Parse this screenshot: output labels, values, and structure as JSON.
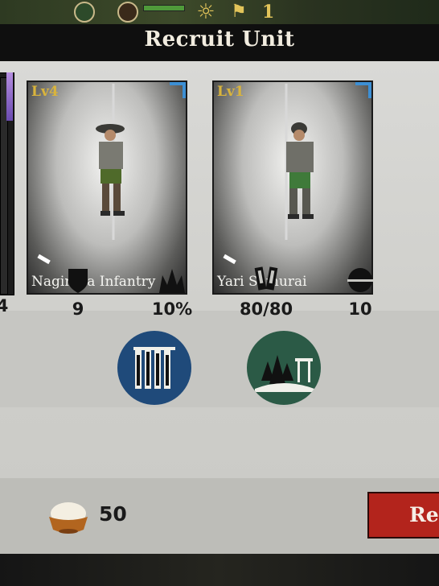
{
  "header": {
    "title": "Recruit Unit",
    "top_counter": "1"
  },
  "cards": [
    {
      "level": "Lv4",
      "name": "Naginata Infantry",
      "accent": "#3d8fd4"
    },
    {
      "level": "Lv1",
      "name": "Yari Samurai",
      "accent": "#3d8fd4"
    }
  ],
  "stats": [
    {
      "icon": "attack-icon",
      "value": "4"
    },
    {
      "icon": "shield-icon",
      "value": "9"
    },
    {
      "icon": "crit-burst-icon",
      "value": "10%"
    },
    {
      "icon": "troops-banner-icon",
      "value": "80/80"
    },
    {
      "icon": "helmet-icon",
      "value": "10"
    }
  ],
  "traits": [
    {
      "icon": "spear-formation-icon",
      "color": "#1f4a7a"
    },
    {
      "icon": "forest-shrine-icon",
      "color": "#2b5a46"
    }
  ],
  "footer": {
    "cost": "50",
    "cost_icon": "rice-bowl-icon",
    "recruit_label": "Re"
  }
}
